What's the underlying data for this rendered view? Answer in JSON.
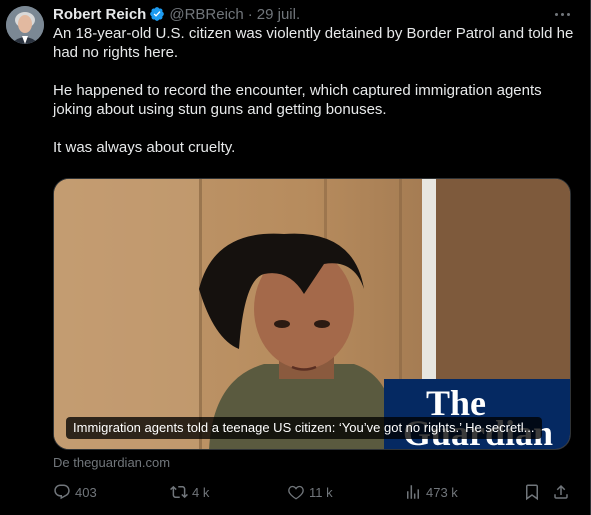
{
  "author": {
    "name": "Robert Reich",
    "handle": "@RBReich",
    "separator": "·",
    "date": "29 juil."
  },
  "tweet": {
    "paragraphs": [
      "An 18-year-old U.S. citizen was violently detained by Border Patrol and told he had no rights here.",
      "He happened to record the encounter, which captured immigration agents joking about using stun guns and getting bonuses.",
      "It was always about cruelty."
    ]
  },
  "card": {
    "caption": "Immigration agents told a teenage US citizen: ‘You’ve got no rights.’ He secretl...",
    "logo_text": "The Guardian",
    "source": "De theguardian.com"
  },
  "actions": {
    "replies": "403",
    "reposts": "4 k",
    "likes": "11 k",
    "views": "473 k"
  },
  "colors": {
    "background": "#000000",
    "text": "#e7e9ea",
    "muted": "#71767b",
    "verified": "#1d9bf0",
    "guardian_blue": "#052962"
  }
}
